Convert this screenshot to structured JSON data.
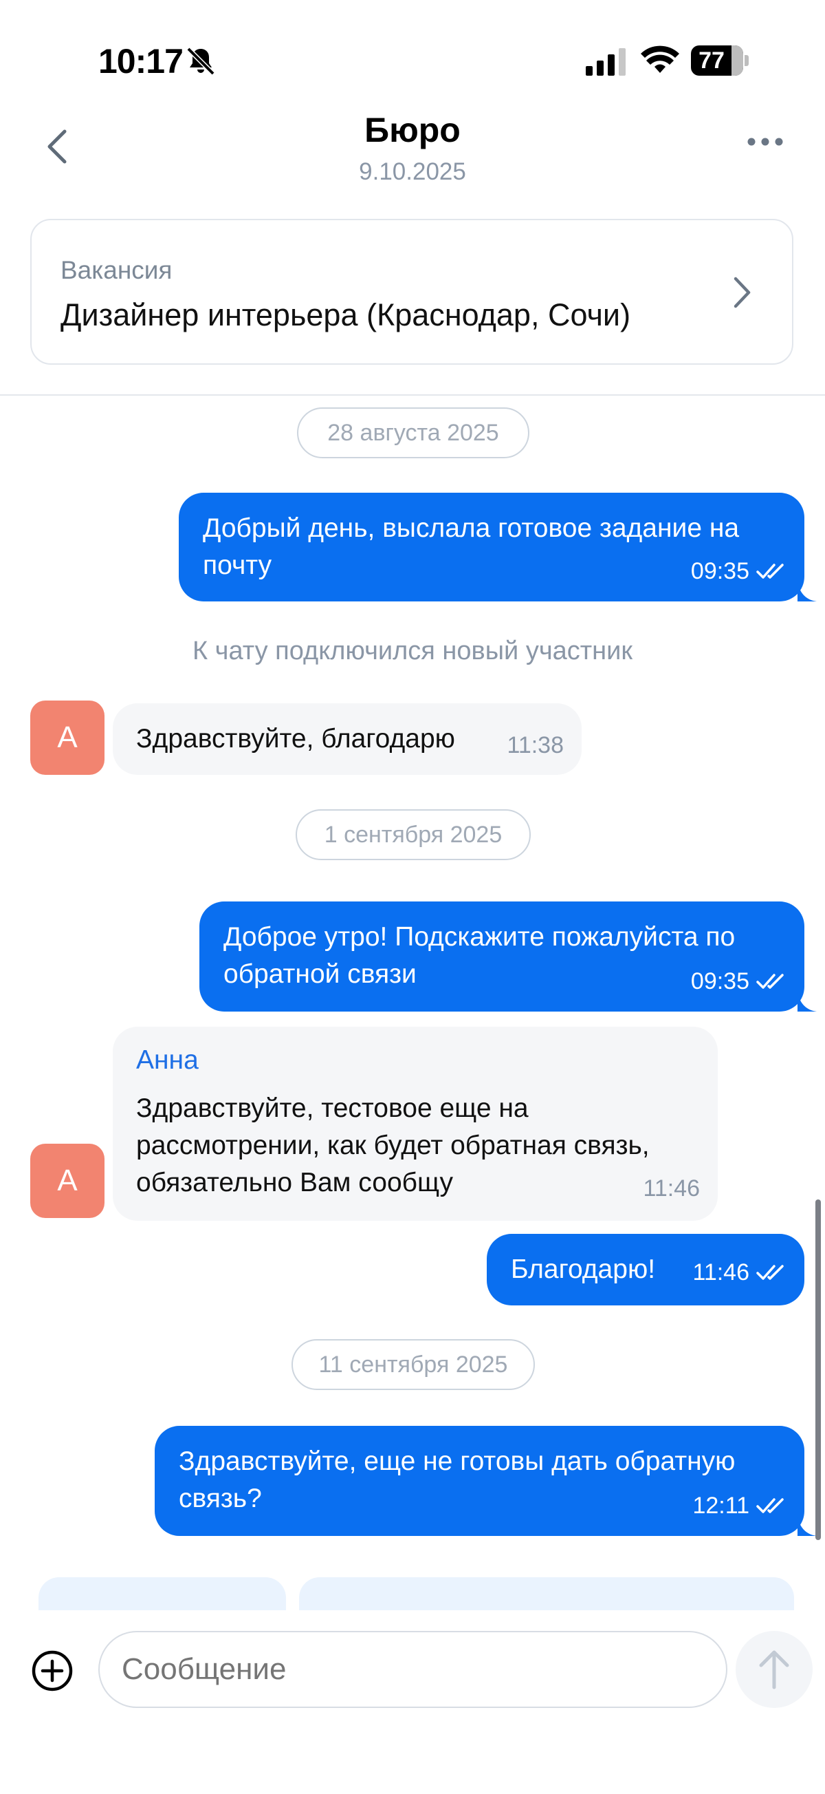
{
  "status_bar": {
    "time": "10:17",
    "battery": "77"
  },
  "header": {
    "title": "Бюро",
    "subtitle": "9.10.2025"
  },
  "vacancy": {
    "label": "Вакансия",
    "title": "Дизайнер интерьера (Краснодар, Сочи)"
  },
  "chat": {
    "date_1": "28 августа 2025",
    "msg_1": {
      "line1": "Добрый день, выслала готовое задание на",
      "line2": "почту",
      "time": "09:35"
    },
    "system": "К чату подключился новый участник",
    "avatar_letter": "А",
    "msg_2": {
      "text": "Здравствуйте, благодарю",
      "time": "11:38"
    },
    "date_2": "1 сентября 2025",
    "msg_3": {
      "line1": "Доброе утро! Подскажите пожалуйста по",
      "line2": "обратной связи",
      "time": "09:35"
    },
    "msg_4": {
      "sender": "Анна",
      "line1": "Здравствуйте, тестовое еще на",
      "line2": "рассмотрении, как будет обратная связь,",
      "line3": "обязательно Вам сообщу",
      "time": "11:46"
    },
    "msg_5": {
      "text": "Благодарю!",
      "time": "11:46"
    },
    "date_3": "11 сентября 2025",
    "msg_6": {
      "line1": "Здравствуйте, еще не готовы дать обратную",
      "line2": "связь?",
      "time": "12:11"
    }
  },
  "composer": {
    "placeholder": "Сообщение"
  },
  "colors": {
    "accent": "#0a6ff0",
    "avatar": "#f28470",
    "muted": "#8a96a6"
  },
  "icons": [
    "bell-slash-icon",
    "signal-icon",
    "wifi-icon",
    "battery-icon",
    "back-icon",
    "more-icon",
    "chevron-right-icon",
    "double-check-icon",
    "plus-icon",
    "send-arrow-icon"
  ]
}
